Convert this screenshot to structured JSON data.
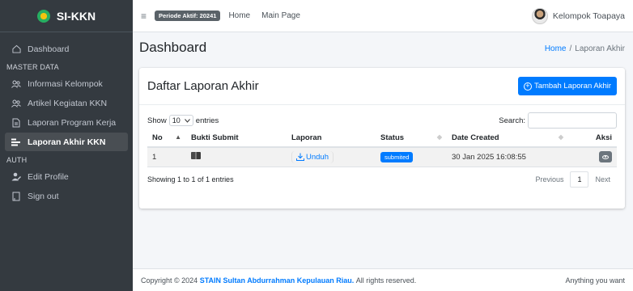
{
  "brand": {
    "name": "SI-KKN"
  },
  "sidebar": {
    "items": [
      {
        "label": "Dashboard",
        "icon": "home-icon"
      },
      {
        "header": "MASTER DATA"
      },
      {
        "label": "Informasi Kelompok",
        "icon": "users-icon"
      },
      {
        "label": "Artikel Kegiatan KKN",
        "icon": "users-icon"
      },
      {
        "label": "Laporan Program Kerja",
        "icon": "document-icon"
      },
      {
        "label": "Laporan Akhir KKN",
        "icon": "tasks-icon",
        "active": true
      },
      {
        "header": "AUTH"
      },
      {
        "label": "Edit Profile",
        "icon": "user-edit-icon"
      },
      {
        "label": "Sign out",
        "icon": "signout-icon"
      }
    ]
  },
  "topbar": {
    "periode": "Periode Aktif: 20241",
    "links": [
      "Home",
      "Main Page"
    ],
    "user": "Kelompok Toapaya"
  },
  "page": {
    "title": "Dashboard",
    "breadcrumb": {
      "home": "Home",
      "separator": "/",
      "current": "Laporan Akhir"
    }
  },
  "card": {
    "title": "Daftar Laporan Akhir",
    "add_button": "Tambah Laporan Akhir",
    "length": {
      "show": "Show",
      "value": "10",
      "entries": "entries"
    },
    "search_label": "Search:",
    "columns": [
      "No",
      "Bukti Submit",
      "Laporan",
      "Status",
      "Date Created",
      "Aksi"
    ],
    "rows": [
      {
        "no": "1",
        "laporan": "Unduh",
        "status": "submited",
        "date": "30 Jan 2025 16:08:55"
      }
    ],
    "info": "Showing 1 to 1 of 1 entries",
    "pager": {
      "previous": "Previous",
      "page": "1",
      "next": "Next"
    }
  },
  "footer": {
    "prefix": "Copyright © 2024",
    "institution": "STAIN Sultan Abdurrahman Kepulauan Riau.",
    "suffix": "All rights reserved.",
    "right": "Anything you want"
  },
  "colors": {
    "sidebar": "#343a40",
    "primary": "#007bff",
    "badge": "#5a6268"
  }
}
